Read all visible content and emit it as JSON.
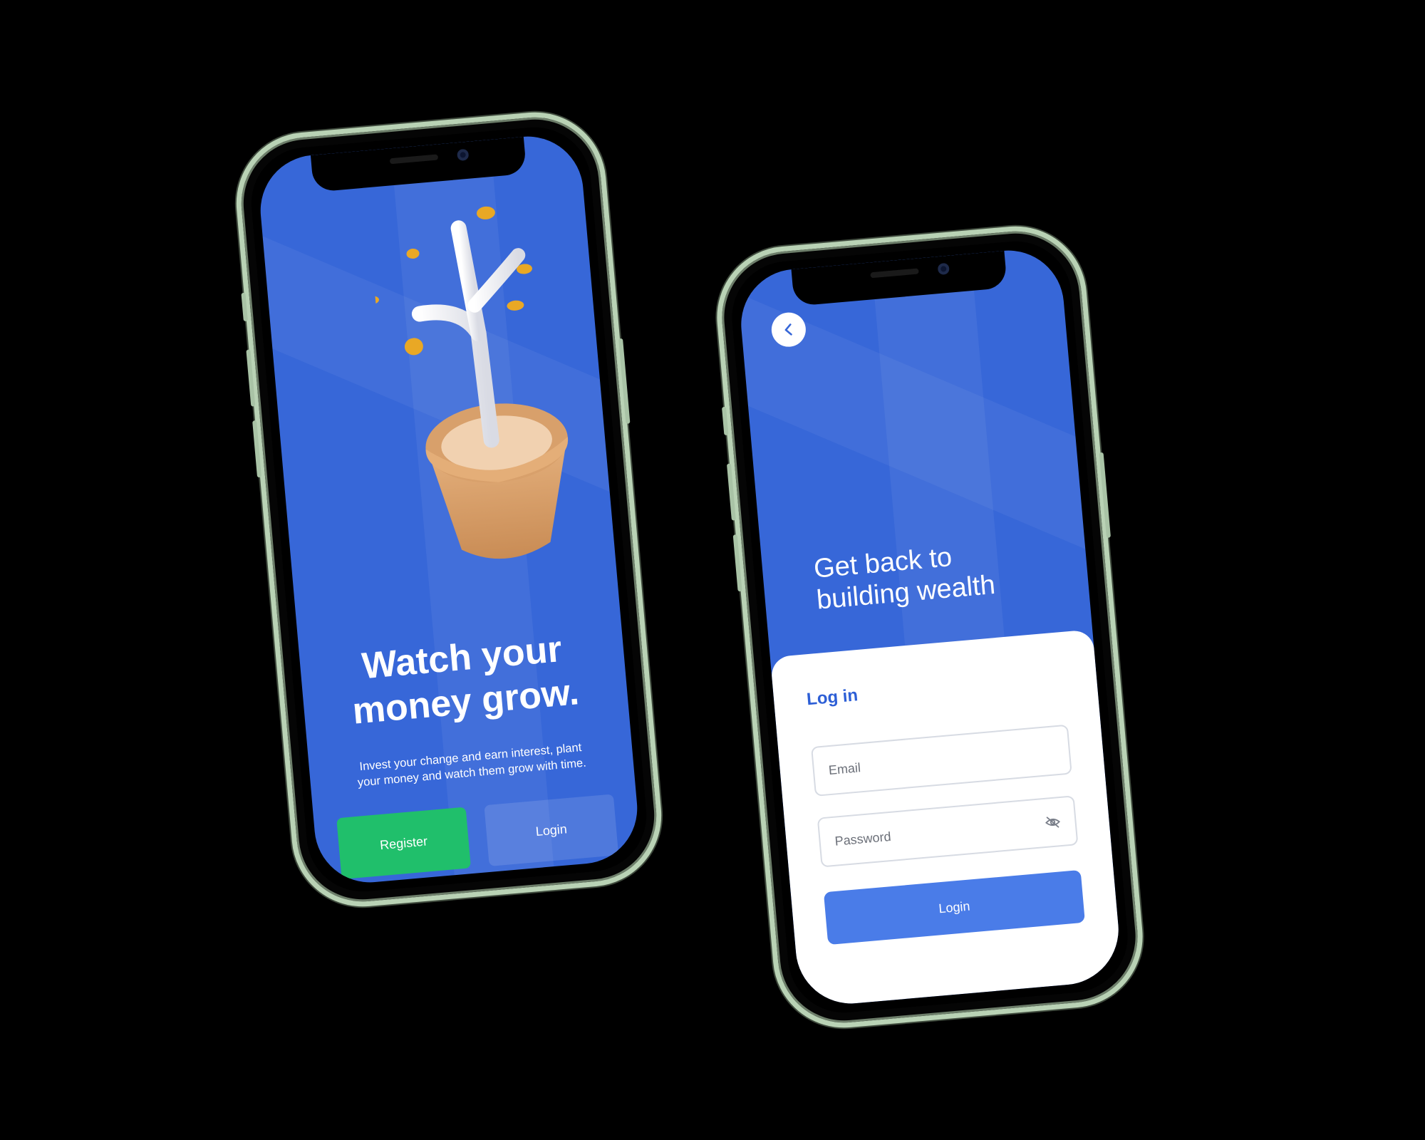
{
  "onboarding": {
    "headline": "Watch your\nmoney grow.",
    "subtext": "Invest your change and earn interest, plant your money and watch them grow with time.",
    "register_label": "Register",
    "login_label": "Login",
    "illustration": "plant-with-coins-icon"
  },
  "login_screen": {
    "back_icon": "chevron-left-icon",
    "hero": "Get back to\nbuilding wealth",
    "panel_title": "Log in",
    "email_placeholder": "Email",
    "password_placeholder": "Password",
    "password_toggle_icon": "eye-off-icon",
    "submit_label": "Login"
  },
  "colors": {
    "background": "#000000",
    "screen_blue": "#3767d8",
    "register_green": "#20bf6b",
    "login_blue": "#4a7ce8",
    "frame": "#b9d2b5"
  }
}
